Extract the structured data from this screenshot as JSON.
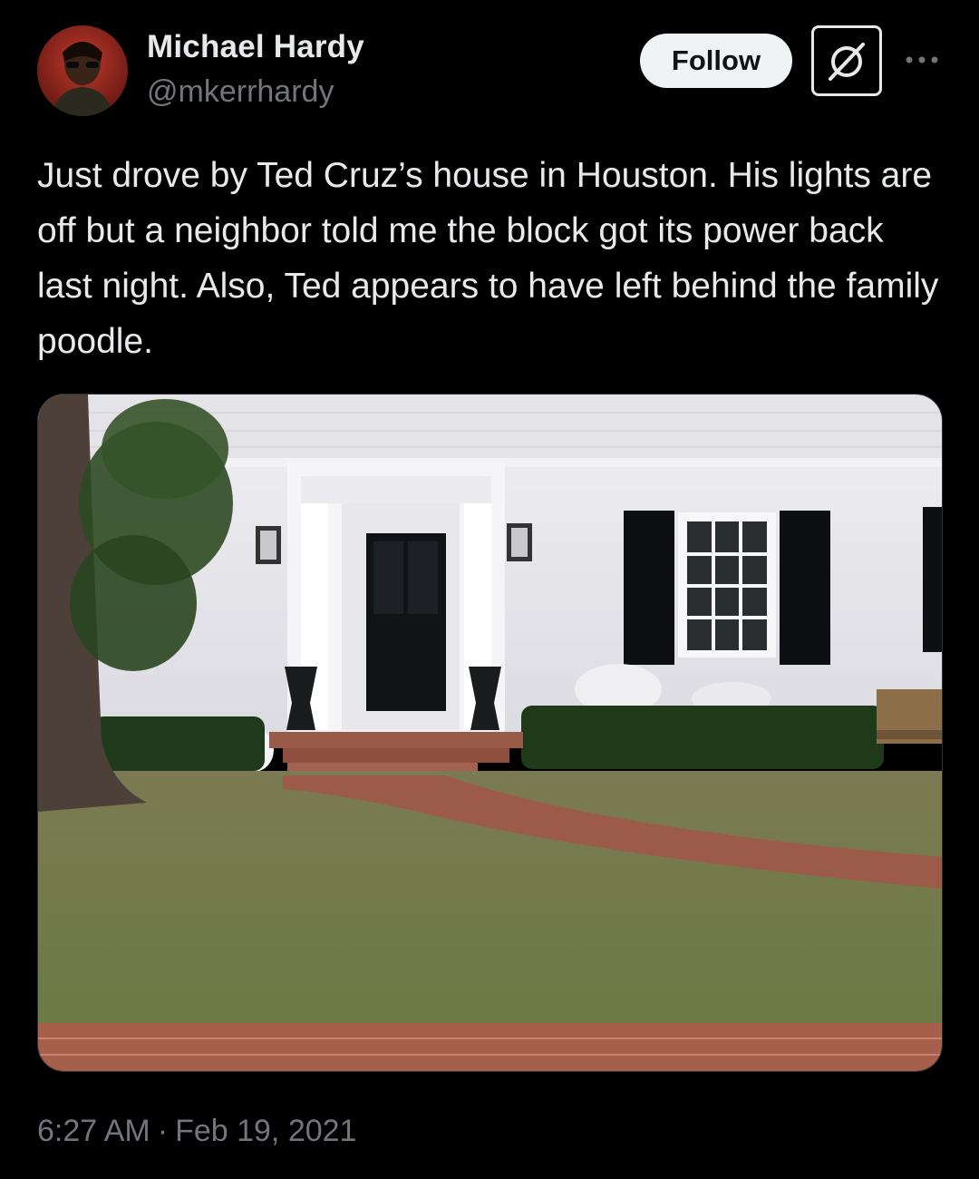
{
  "author": {
    "display_name": "Michael Hardy",
    "handle": "@mkerrhardy",
    "avatar_icon": "profile-photo"
  },
  "header": {
    "follow_label": "Follow",
    "grok_icon": "grok-icon",
    "more_icon": "more-horizontal-icon"
  },
  "tweet": {
    "text": "Just drove by Ted Cruz’s house in Houston. His lights are off but a neighbor told me the block got its power back last night. Also, Ted appears to have left behind the family poodle.",
    "time": "6:27 AM",
    "separator": "·",
    "date": "Feb 19, 2021"
  },
  "colors": {
    "background": "#000000",
    "primary_text": "#e7e9ea",
    "secondary_text": "#71767b",
    "follow_bg": "#eff3f4"
  }
}
